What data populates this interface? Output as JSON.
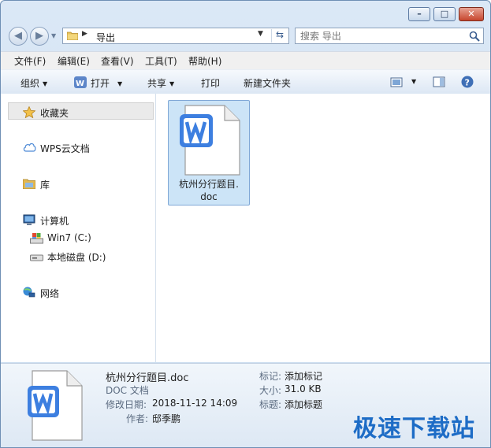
{
  "window": {
    "controls": {
      "minimize": "–",
      "maximize": "□",
      "close": "✕"
    }
  },
  "address_bar": {
    "path": "导出"
  },
  "search": {
    "placeholder": "搜索 导出"
  },
  "menu": [
    "文件(F)",
    "编辑(E)",
    "查看(V)",
    "工具(T)",
    "帮助(H)"
  ],
  "toolbar": {
    "organize": "组织",
    "open": "打开",
    "share": "共享",
    "print": "打印",
    "new_folder": "新建文件夹"
  },
  "nav": {
    "favorites": "收藏夹",
    "wps_cloud": "WPS云文档",
    "libraries": "库",
    "computer": "计算机",
    "drive_c": "Win7 (C:)",
    "drive_d": "本地磁盘 (D:)",
    "network": "网络"
  },
  "file": {
    "name_line1": "杭州分行题目.",
    "name_line2": "doc"
  },
  "details": {
    "filename": "杭州分行题目.doc",
    "type": "DOC 文档",
    "modified_label": "修改日期:",
    "modified_value": "2018-11-12 14:09",
    "author_label": "作者:",
    "author_value": "邸季鹏",
    "tags_label": "标记:",
    "tags_value": "添加标记",
    "size_label": "大小:",
    "size_value": "31.0 KB",
    "title_label": "标题:",
    "title_value": "添加标题"
  },
  "watermark": "极速下载站",
  "colors": {
    "accent": "#1d6cc6",
    "selection": "#cce4f7",
    "wps_blue": "#3d7fe0"
  }
}
